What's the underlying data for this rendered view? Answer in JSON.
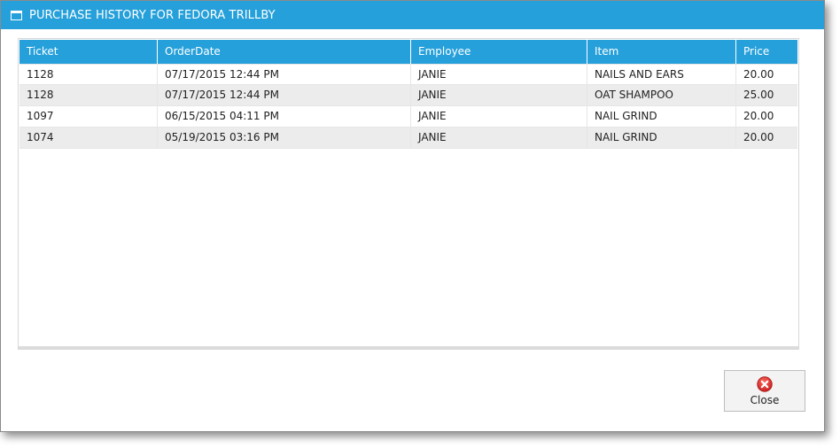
{
  "window": {
    "title": "PURCHASE HISTORY FOR FEDORA TRILLBY",
    "title_icon": "window-icon",
    "accent_color": "#26a0da"
  },
  "grid": {
    "columns": [
      "Ticket",
      "OrderDate",
      "Employee",
      "Item",
      "Price"
    ],
    "rows": [
      [
        "1128",
        "07/17/2015 12:44 PM",
        "JANIE",
        "NAILS AND EARS",
        "20.00"
      ],
      [
        "1128",
        "07/17/2015 12:44 PM",
        "JANIE",
        "OAT SHAMPOO",
        "25.00"
      ],
      [
        "1097",
        "06/15/2015 04:11 PM",
        "JANIE",
        "NAIL GRIND",
        "20.00"
      ],
      [
        "1074",
        "05/19/2015 03:16 PM",
        "JANIE",
        "NAIL GRIND",
        "20.00"
      ]
    ]
  },
  "footer": {
    "close_label": "Close",
    "close_icon": "close-circle-icon",
    "close_icon_color": "#e0332b"
  }
}
